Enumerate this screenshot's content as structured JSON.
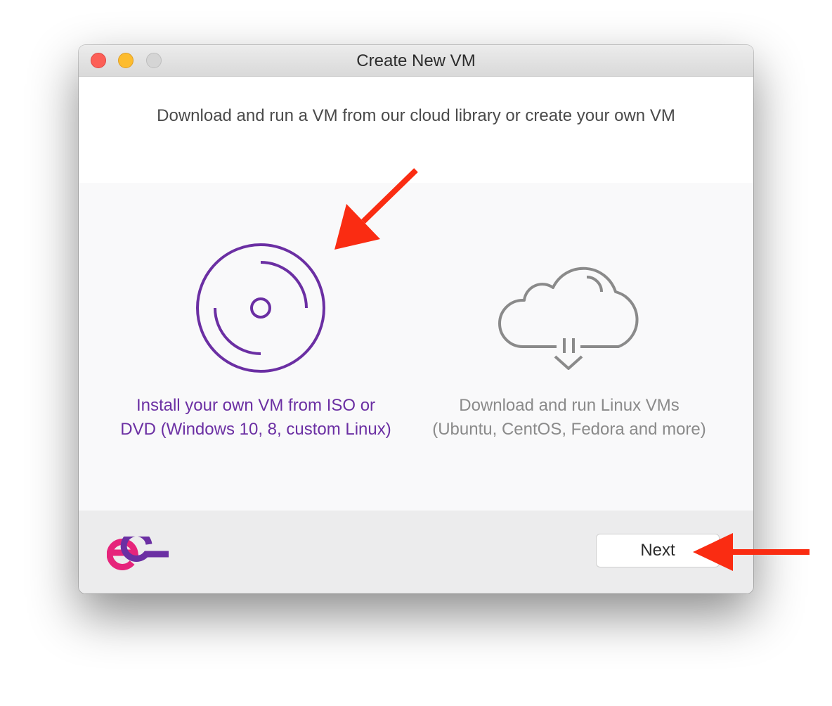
{
  "window": {
    "title": "Create New VM",
    "controls": [
      "close",
      "minimize",
      "zoom"
    ]
  },
  "header": {
    "subtitle": "Download and run a VM from our cloud library or create your own VM"
  },
  "options": [
    {
      "id": "install-iso",
      "icon": "disc-icon",
      "line1": "Install your own VM from ISO or",
      "line2": "DVD (Windows 10, 8, custom Linux)",
      "selected": true,
      "color": "#6b2fa3"
    },
    {
      "id": "download-linux",
      "icon": "cloud-download-icon",
      "line1": "Download and run Linux VMs",
      "line2": "(Ubuntu, CentOS, Fedora and more)",
      "selected": false,
      "color": "#8a8a8a"
    }
  ],
  "footer": {
    "logo": "ee-logo",
    "next_label": "Next"
  },
  "annotations": {
    "arrow_color": "#fa2c12"
  }
}
